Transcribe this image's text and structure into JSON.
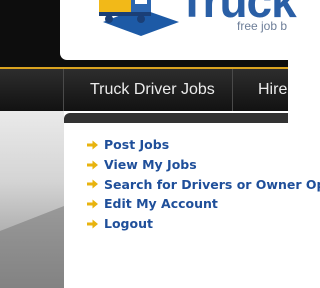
{
  "logo": {
    "wordmark": "Truck",
    "tagline": "free job b"
  },
  "nav": {
    "items": [
      {
        "label": "Truck Driver Jobs"
      },
      {
        "label": "Hire"
      }
    ]
  },
  "menu": {
    "items": [
      {
        "label": "Post Jobs"
      },
      {
        "label": "View My Jobs"
      },
      {
        "label": "Search for Drivers or Owner Ope"
      },
      {
        "label": "Edit My Account"
      },
      {
        "label": "Logout"
      }
    ]
  },
  "colors": {
    "link": "#1f4f9a",
    "arrow": "#e8b30e",
    "accent": "#d9a320",
    "logo_blue": "#2a5fa6"
  }
}
